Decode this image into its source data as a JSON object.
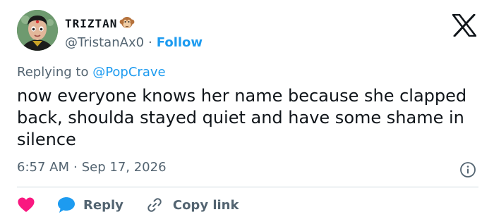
{
  "author": {
    "display_name": "TRIZTAN",
    "name_emoji": "monkey-emoji",
    "handle": "@TristanAx0",
    "separator": "·",
    "follow_label": "Follow"
  },
  "reply_context": {
    "prefix": "Replying to ",
    "mention": "@PopCrave"
  },
  "tweet": {
    "text": "now everyone knows her name because she clapped back, shoulda stayed quiet and have some shame in silence",
    "time": "6:57 AM",
    "separator": "·",
    "date": "Sep 17, 2026"
  },
  "actions": {
    "reply_label": "Reply",
    "copy_label": "Copy link"
  },
  "icons": {
    "brand": "x-logo",
    "info": "info-icon",
    "like": "heart-icon",
    "reply": "speech-bubble-icon",
    "copy": "link-icon"
  },
  "colors": {
    "accent": "#1d9bf0",
    "like": "#f91880",
    "secondary_text": "#536471",
    "divider": "#cfd9de"
  }
}
